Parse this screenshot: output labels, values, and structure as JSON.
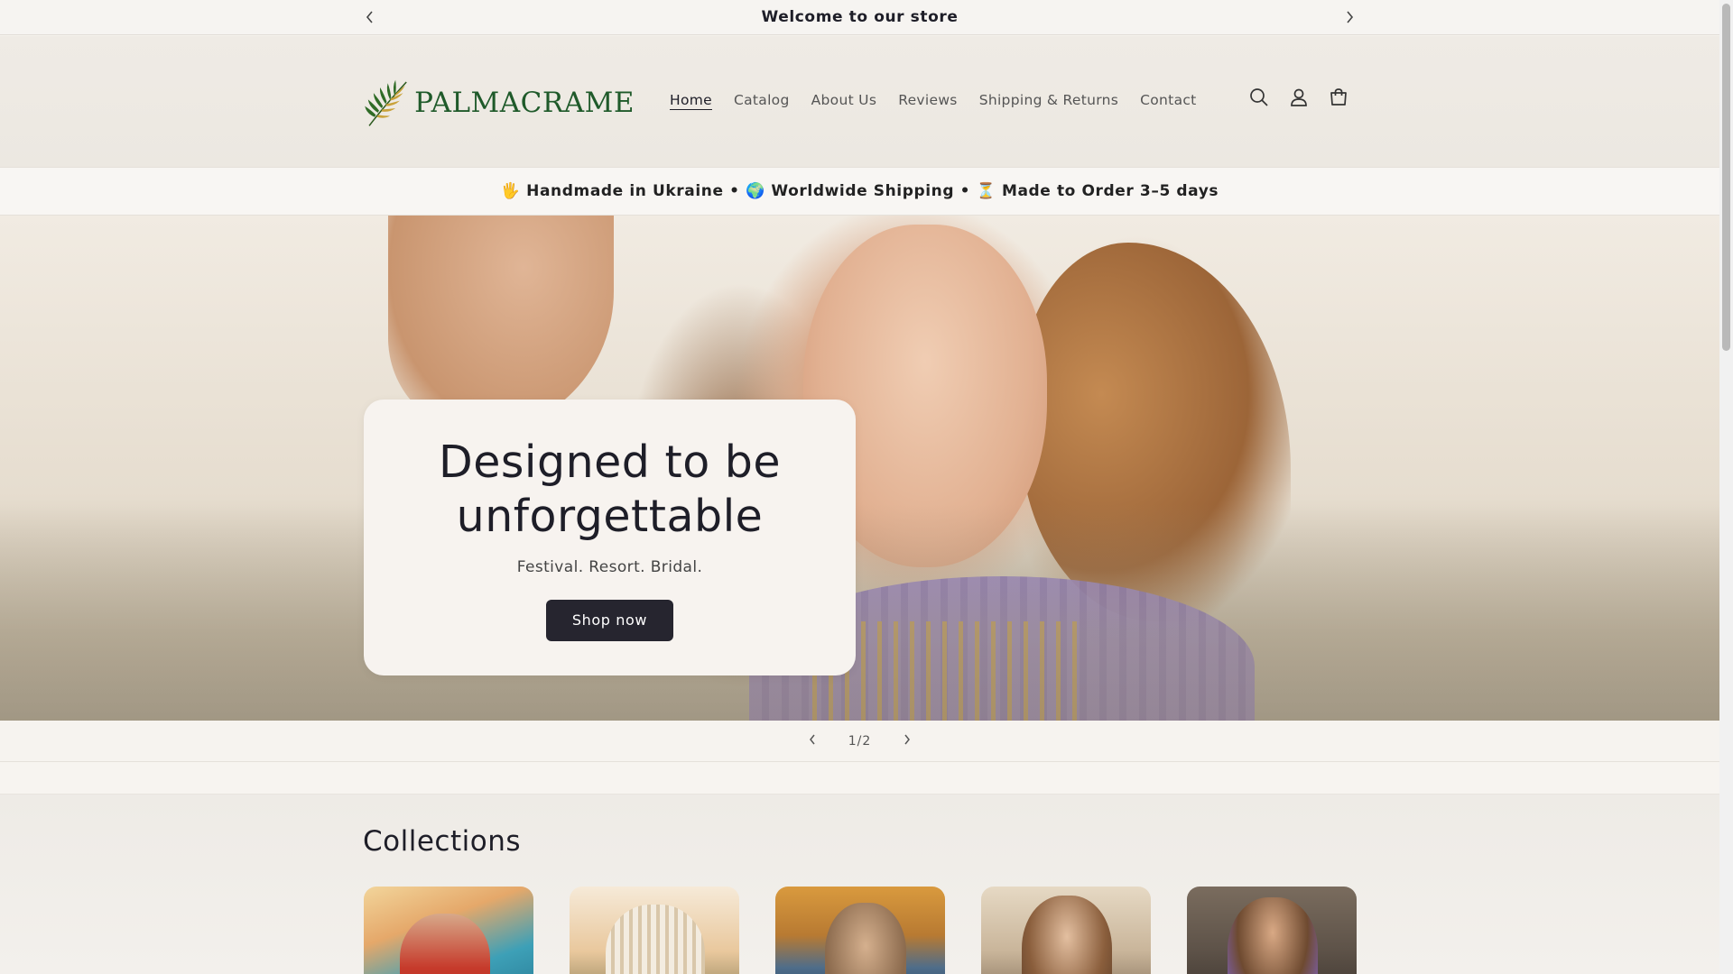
{
  "announcement": {
    "text": "Welcome to our store",
    "prev_icon": "chevron-left-icon",
    "next_icon": "chevron-right-icon"
  },
  "header": {
    "brand": "PALMACRAME",
    "logo_icon": "palm-leaf-icon",
    "nav": [
      {
        "label": "Home",
        "active": true
      },
      {
        "label": "Catalog",
        "active": false
      },
      {
        "label": "About Us",
        "active": false
      },
      {
        "label": "Reviews",
        "active": false
      },
      {
        "label": "Shipping & Returns",
        "active": false
      },
      {
        "label": "Contact",
        "active": false
      }
    ],
    "icons": [
      "search-icon",
      "account-icon",
      "cart-icon"
    ]
  },
  "trust_bar": {
    "text": "🖐 Handmade in Ukraine • 🌍 Worldwide Shipping • ⏳ Made to Order 3–5 days"
  },
  "hero": {
    "title": "Designed to be unforgettable",
    "subtitle": "Festival. Resort. Bridal.",
    "cta_label": "Shop now"
  },
  "slider": {
    "counter": "1/2",
    "prev_icon": "chevron-left-icon",
    "next_icon": "chevron-right-icon"
  },
  "collections": {
    "heading": "Collections",
    "card_count_visible": 5
  },
  "colors": {
    "brand_green": "#1f5a2a",
    "button_dark": "#26252f",
    "background": "#f4f1ec"
  }
}
